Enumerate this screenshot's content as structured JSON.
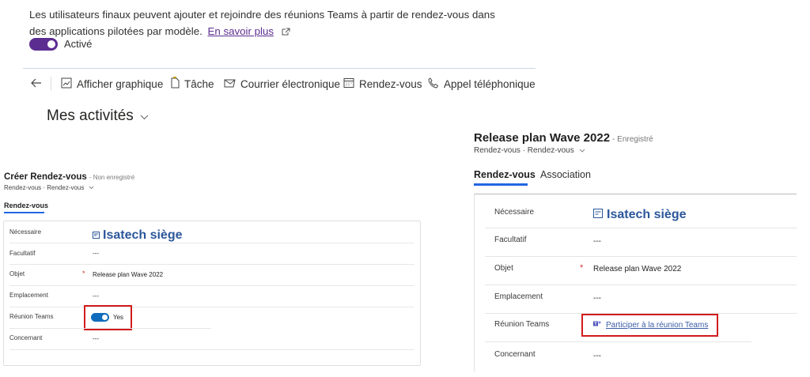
{
  "description": {
    "text": "Les utilisateurs finaux peuvent ajouter et rejoindre des réunions Teams à partir de rendez-vous dans des applications pilotées par modèle.",
    "link": "En savoir plus"
  },
  "feature_toggle": {
    "label": "Activé",
    "on": true
  },
  "commandbar": {
    "items": [
      "Afficher graphique",
      "Tâche",
      "Courrier électronique",
      "Rendez-vous",
      "Appel téléphonique"
    ],
    "highlighted": "Rendez-vous"
  },
  "view_title": "Mes activités",
  "left_form": {
    "title": "Créer Rendez-vous",
    "status": "- Non enregistré",
    "breadcrumb": "Rendez-vous · Rendez-vous",
    "tab": "Rendez-vous",
    "fields": [
      {
        "label": "Nécessaire",
        "value": "Isatech siège"
      },
      {
        "label": "Facultatif",
        "value": "---"
      },
      {
        "label": "Objet",
        "value": "Release plan Wave 2022",
        "required": true
      },
      {
        "label": "Emplacement",
        "value": "---"
      },
      {
        "label": "Réunion Teams",
        "value": "Yes",
        "toggle_on": true
      },
      {
        "label": "Concernant",
        "value": "---"
      }
    ]
  },
  "right_form": {
    "title": "Release plan Wave 2022",
    "status": "- Enregistré",
    "breadcrumb": "Rendez-vous · Rendez-vous",
    "tabs": [
      "Rendez-vous",
      "Association"
    ],
    "fields": [
      {
        "label": "Nécessaire",
        "value": "Isatech siège"
      },
      {
        "label": "Facultatif",
        "value": "---"
      },
      {
        "label": "Objet",
        "value": "Release plan Wave 2022",
        "required": true
      },
      {
        "label": "Emplacement",
        "value": "---"
      },
      {
        "label": "Réunion Teams",
        "value": "Participer à la réunion Teams"
      },
      {
        "label": "Concernant",
        "value": "---"
      }
    ]
  },
  "colors": {
    "accent_purple": "#5c2d91",
    "highlight_red": "#d11b1b",
    "link_blue": "#2b579a",
    "toggle_blue": "#0f6cbd"
  }
}
